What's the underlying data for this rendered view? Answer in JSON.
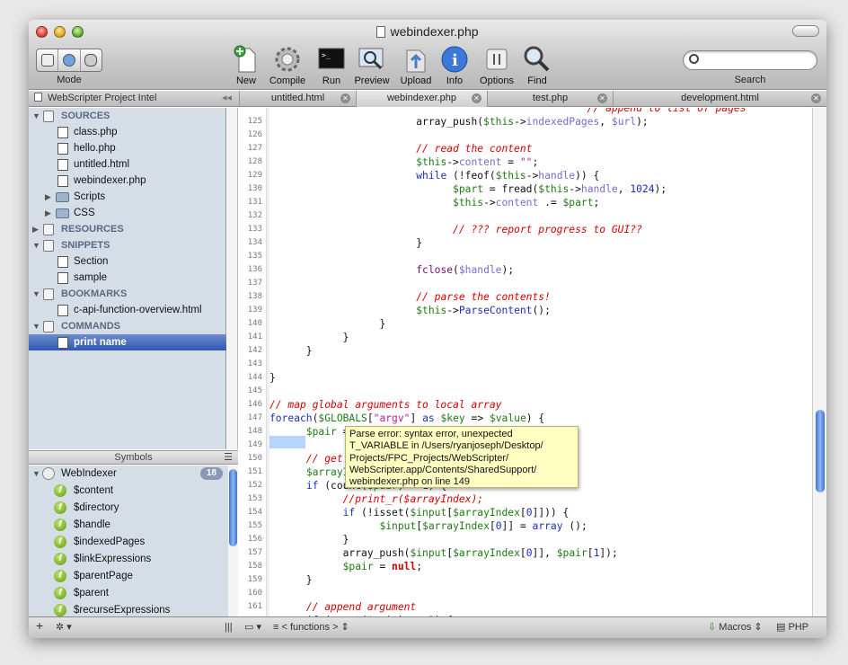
{
  "window": {
    "title": "webindexer.php"
  },
  "toolbar": {
    "mode_label": "Mode",
    "buttons": [
      {
        "label": "New",
        "icon": "new-icon"
      },
      {
        "label": "Compile",
        "icon": "gear-icon"
      },
      {
        "label": "Run",
        "icon": "terminal-icon"
      },
      {
        "label": "Preview",
        "icon": "preview-icon"
      },
      {
        "label": "Upload",
        "icon": "upload-icon"
      },
      {
        "label": "Info",
        "icon": "info-icon"
      },
      {
        "label": "Options",
        "icon": "options-icon"
      },
      {
        "label": "Find",
        "icon": "magnifier-icon"
      }
    ],
    "search_label": "Search",
    "search_placeholder": ""
  },
  "project_tab": {
    "label": "WebScripter Project Intel"
  },
  "tabs": [
    {
      "label": "untitled.html",
      "active": false
    },
    {
      "label": "webindexer.php",
      "active": true
    },
    {
      "label": "test.php",
      "active": false
    },
    {
      "label": "development.html",
      "active": false
    }
  ],
  "sidebar": {
    "items": [
      {
        "label": "SOURCES",
        "kind": "header",
        "icon": "sources-icon"
      },
      {
        "label": "class.php",
        "kind": "file"
      },
      {
        "label": "hello.php",
        "kind": "file"
      },
      {
        "label": "untitled.html",
        "kind": "file"
      },
      {
        "label": "webindexer.php",
        "kind": "file"
      },
      {
        "label": "Scripts",
        "kind": "folder"
      },
      {
        "label": "CSS",
        "kind": "folder"
      },
      {
        "label": "RESOURCES",
        "kind": "header",
        "icon": "resources-icon"
      },
      {
        "label": "SNIPPETS",
        "kind": "header",
        "icon": "snippets-icon"
      },
      {
        "label": "Section",
        "kind": "file"
      },
      {
        "label": "sample",
        "kind": "file"
      },
      {
        "label": "BOOKMARKS",
        "kind": "header",
        "icon": "bookmarks-icon"
      },
      {
        "label": "c-api-function-overview.html",
        "kind": "file"
      },
      {
        "label": "COMMANDS",
        "kind": "header",
        "icon": "commands-icon"
      },
      {
        "label": "print name",
        "kind": "selected"
      }
    ]
  },
  "symbols": {
    "header": "Symbols",
    "root": {
      "label": "WebIndexer",
      "count": "18"
    },
    "items": [
      "$content",
      "$directory",
      "$handle",
      "$indexedPages",
      "$linkExpressions",
      "$parentPage",
      "$parent",
      "$recurseExpressions"
    ]
  },
  "editor": {
    "line_numbers": [
      "125",
      "126",
      "127",
      "128",
      "129",
      "130",
      "131",
      "132",
      "133",
      "134",
      "135",
      "136",
      "137",
      "138",
      "139",
      "140",
      "141",
      "142",
      "143",
      "144",
      "145",
      "146",
      "147",
      "148",
      "149",
      "150",
      "151",
      "152",
      "153",
      "154",
      "155",
      "156",
      "157",
      "158",
      "159",
      "160",
      "161"
    ],
    "tooltip": "Parse error: syntax error, unexpected\nT_VARIABLE in /Users/ryanjoseph/Desktop/\nProjects/FPC_Projects/WebScripter/\nWebScripter.app/Contents/SharedSupport/\nwebindexer.php on line 149"
  },
  "bottombar": {
    "functions_label": "< functions >",
    "macros_label": "Macros",
    "language_label": "PHP"
  }
}
